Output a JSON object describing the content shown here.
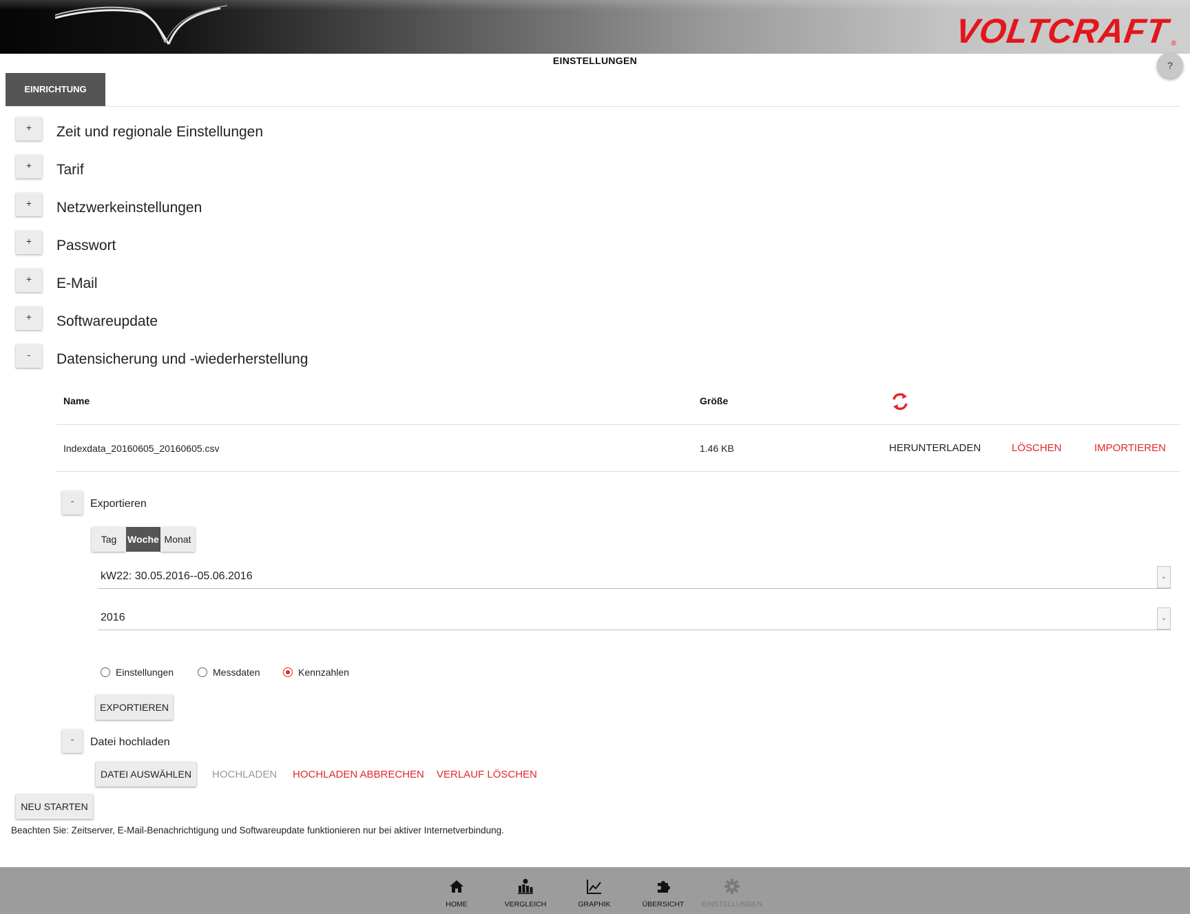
{
  "header": {
    "logo": "VOLTCRAFT",
    "logo_mark": "®",
    "page_title": "EINSTELLUNGEN",
    "help_label": "?"
  },
  "tabs": [
    {
      "label": "EINRICHTUNG",
      "active": true
    }
  ],
  "accordion": [
    {
      "toggle": "+",
      "label": "Zeit und regionale Einstellungen"
    },
    {
      "toggle": "+",
      "label": "Tarif"
    },
    {
      "toggle": "+",
      "label": "Netzwerkeinstellungen"
    },
    {
      "toggle": "+",
      "label": "Passwort"
    },
    {
      "toggle": "+",
      "label": "E-Mail"
    },
    {
      "toggle": "+",
      "label": "Softwareupdate"
    },
    {
      "toggle": "-",
      "label": "Datensicherung und -wiederherstellung"
    }
  ],
  "backup": {
    "columns": {
      "name": "Name",
      "size": "Größe"
    },
    "refresh_icon": "refresh-icon",
    "files": [
      {
        "name": "Indexdata_20160605_20160605.csv",
        "size": "1.46 KB",
        "download": "HERUNTERLADEN",
        "delete": "LÖSCHEN",
        "import": "IMPORTIEREN"
      }
    ],
    "export": {
      "toggle": "-",
      "label": "Exportieren",
      "periods": [
        "Tag",
        "Woche",
        "Monat"
      ],
      "selected_period": "Woche",
      "week_value": "kW22: 30.05.2016--05.06.2016",
      "year_value": "2016",
      "data_types": [
        "Einstellungen",
        "Messdaten",
        "Kennzahlen"
      ],
      "selected_type": "Kennzahlen",
      "button": "EXPORTIEREN"
    },
    "upload": {
      "toggle": "-",
      "label": "Datei hochladen",
      "choose": "DATEI AUSWÄHLEN",
      "upload": "HOCHLADEN",
      "cancel": "HOCHLADEN ABBRECHEN",
      "clear": "VERLAUF LÖSCHEN"
    }
  },
  "restart_button": "NEU STARTEN",
  "note": "Beachten Sie: Zeitserver, E-Mail-Benachrichtigung und Softwareupdate funktionieren nur bei aktiver Internetverbindung.",
  "colors": {
    "accent": "#e2262a",
    "tab": "#555555",
    "footer": "#9c9c9c"
  },
  "footer_nav": [
    {
      "label": "HOME",
      "icon": "home-icon"
    },
    {
      "label": "VERGLEICH",
      "icon": "comparison-icon"
    },
    {
      "label": "GRAPHIK",
      "icon": "graph-icon"
    },
    {
      "label": "ÜBERSICHT",
      "icon": "puzzle-icon"
    },
    {
      "label": "EINSTELLUNGEN",
      "icon": "gear-icon",
      "active": true
    }
  ]
}
